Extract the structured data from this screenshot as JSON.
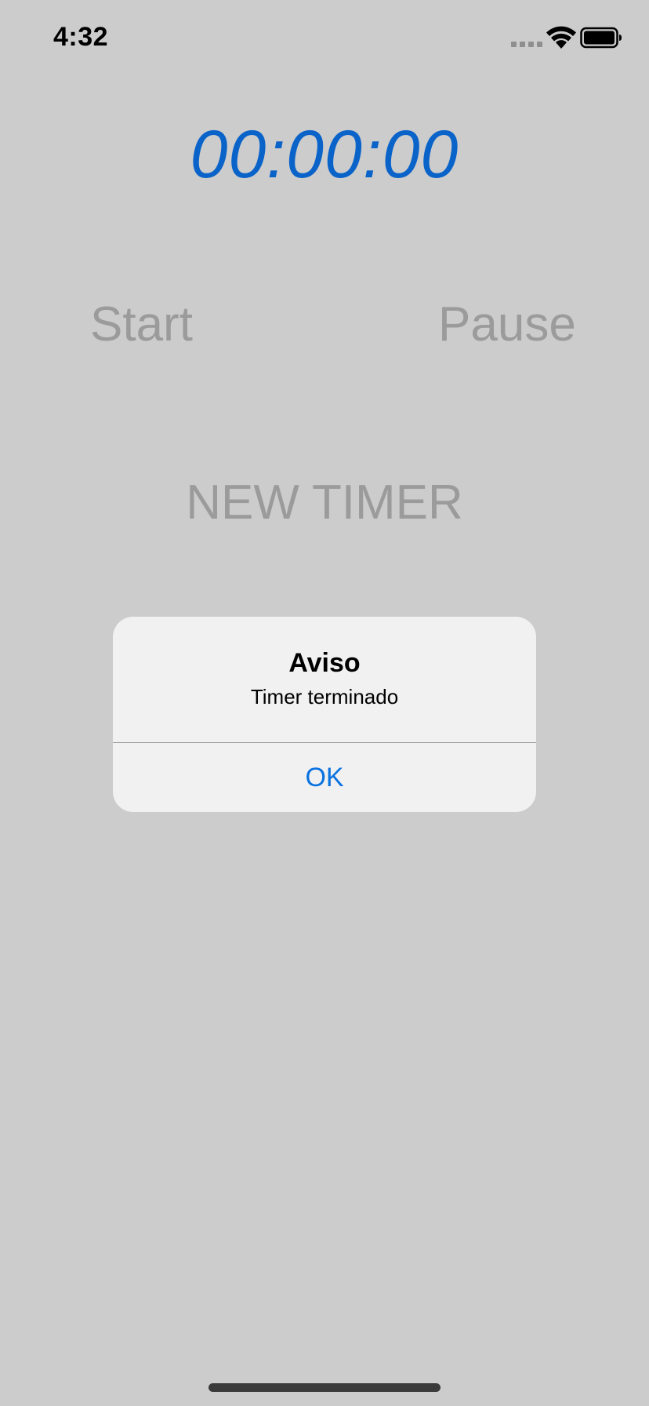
{
  "status_bar": {
    "time": "4:32",
    "icons": [
      "cellular-signal-icon",
      "wifi-icon",
      "battery-icon"
    ]
  },
  "timer": {
    "display": "00:00:00",
    "color": "#0a63c9"
  },
  "controls": {
    "start_label": "Start",
    "pause_label": "Pause",
    "new_timer_label": "NEW TIMER",
    "color": "#9b9b9b"
  },
  "alert": {
    "title": "Aviso",
    "message": "Timer terminado",
    "ok_label": "OK",
    "ok_color": "#0a73e0"
  }
}
